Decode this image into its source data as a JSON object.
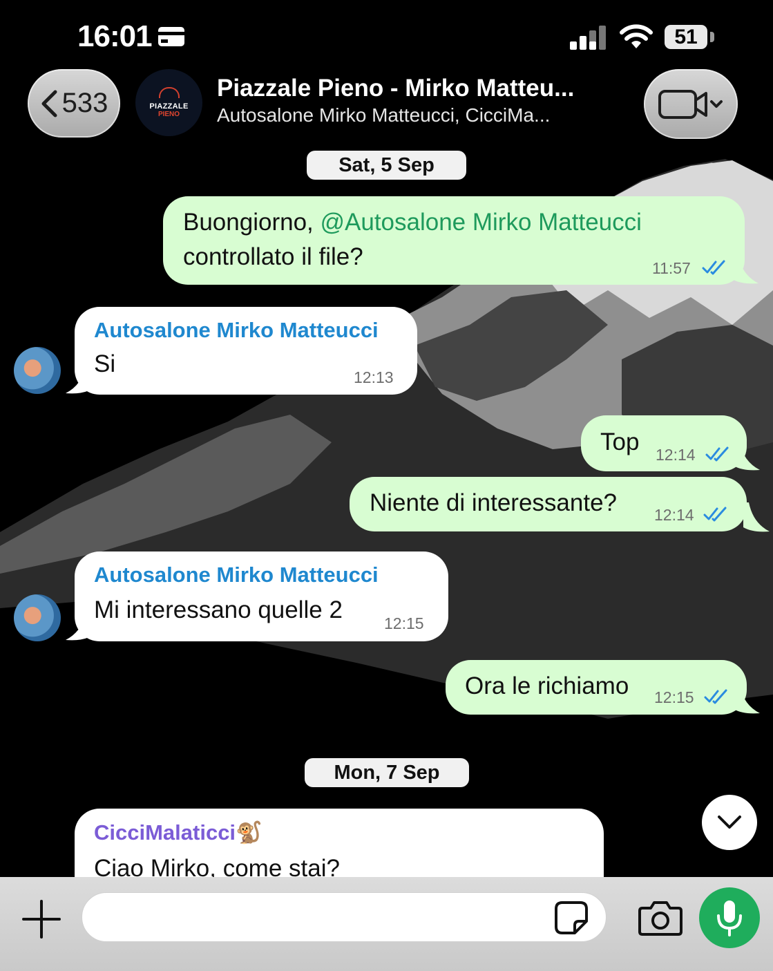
{
  "status_bar": {
    "time": "16:01",
    "battery": "51"
  },
  "header": {
    "back_count": "533",
    "avatar_line1": "PIAZZALE",
    "avatar_line2": "PIENO",
    "title": "Piazzale Pieno - Mirko Matteu...",
    "subtitle": "Autosalone Mirko Matteucci, CicciMa..."
  },
  "dates": {
    "first": "Sat, 5 Sep",
    "second": "Mon, 7 Sep"
  },
  "messages": [
    {
      "direction": "out",
      "text_prefix": "Buongiorno, ",
      "mention": "@Autosalone Mirko Matteucci",
      "text_line2": "controllato il file?",
      "time": "11:57"
    },
    {
      "direction": "in",
      "sender": "Autosalone Mirko Matteucci",
      "text": "Si",
      "time": "12:13"
    },
    {
      "direction": "out",
      "text": "Top",
      "time": "12:14"
    },
    {
      "direction": "out",
      "text": "Niente di interessante?",
      "time": "12:14"
    },
    {
      "direction": "in",
      "sender": "Autosalone Mirko Matteucci",
      "text": "Mi interessano quelle 2",
      "time": "12:15"
    },
    {
      "direction": "out",
      "text": "Ora le richiamo",
      "time": "12:15"
    },
    {
      "direction": "in",
      "sender": "CicciMalaticci",
      "sender_emoji": "🐒",
      "text": "Ciao Mirko, come stai?"
    }
  ],
  "colors": {
    "outgoing_bubble": "#d8fdd2",
    "incoming_bubble": "#ffffff",
    "mention": "#1e9a5c",
    "sender_blue": "#1f88cf",
    "sender_purple": "#7b5cd6",
    "read_ticks": "#2a8be0",
    "mic_button": "#1fad5c"
  },
  "icons": [
    "back-chevron-icon",
    "video-call-icon",
    "chevron-down-icon",
    "plus-icon",
    "sticker-icon",
    "camera-icon",
    "microphone-icon",
    "read-ticks-icon"
  ]
}
